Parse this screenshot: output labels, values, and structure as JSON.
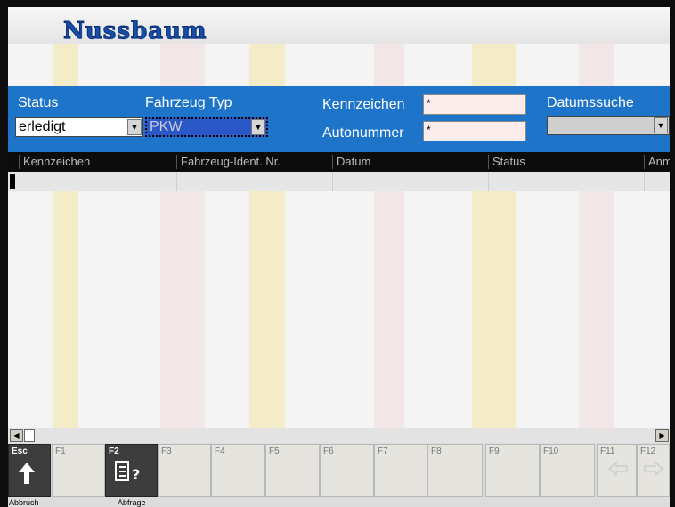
{
  "app": {
    "logo_text": "Nussbaum"
  },
  "filter": {
    "status_label": "Status",
    "status_value": "erledigt",
    "fahrzeug_label": "Fahrzeug Typ",
    "fahrzeug_value": "PKW",
    "kennzeichen_label": "Kennzeichen",
    "kennzeichen_value": "*",
    "autonummer_label": "Autonummer",
    "autonummer_value": "*",
    "datumssuche_label": "Datumssuche",
    "datumssuche_value": ""
  },
  "table": {
    "columns": [
      "Kennzeichen",
      "Fahrzeug-Ident. Nr.",
      "Datum",
      "Status",
      "Anm"
    ]
  },
  "fkeys": {
    "esc": "Esc",
    "f1": "F1",
    "f2": "F2",
    "f3": "F3",
    "f4": "F4",
    "f5": "F5",
    "f6": "F6",
    "f7": "F7",
    "f8": "F8",
    "f9": "F9",
    "f10": "F10",
    "f11": "F11",
    "f12": "F12",
    "esc_caption": "Abbruch",
    "f2_caption": "Abfrage"
  },
  "icons": {
    "esc_icon": "arrow-up-icon",
    "f2_icon": "document-query-icon",
    "f11_icon": "arrow-left-icon",
    "f12_icon": "arrow-right-icon",
    "dropdown_icon": "chevron-down-icon"
  },
  "colors": {
    "filter_bg": "#1d74c9",
    "header_bg": "#0c0c0c",
    "logo": "#174ea8"
  }
}
